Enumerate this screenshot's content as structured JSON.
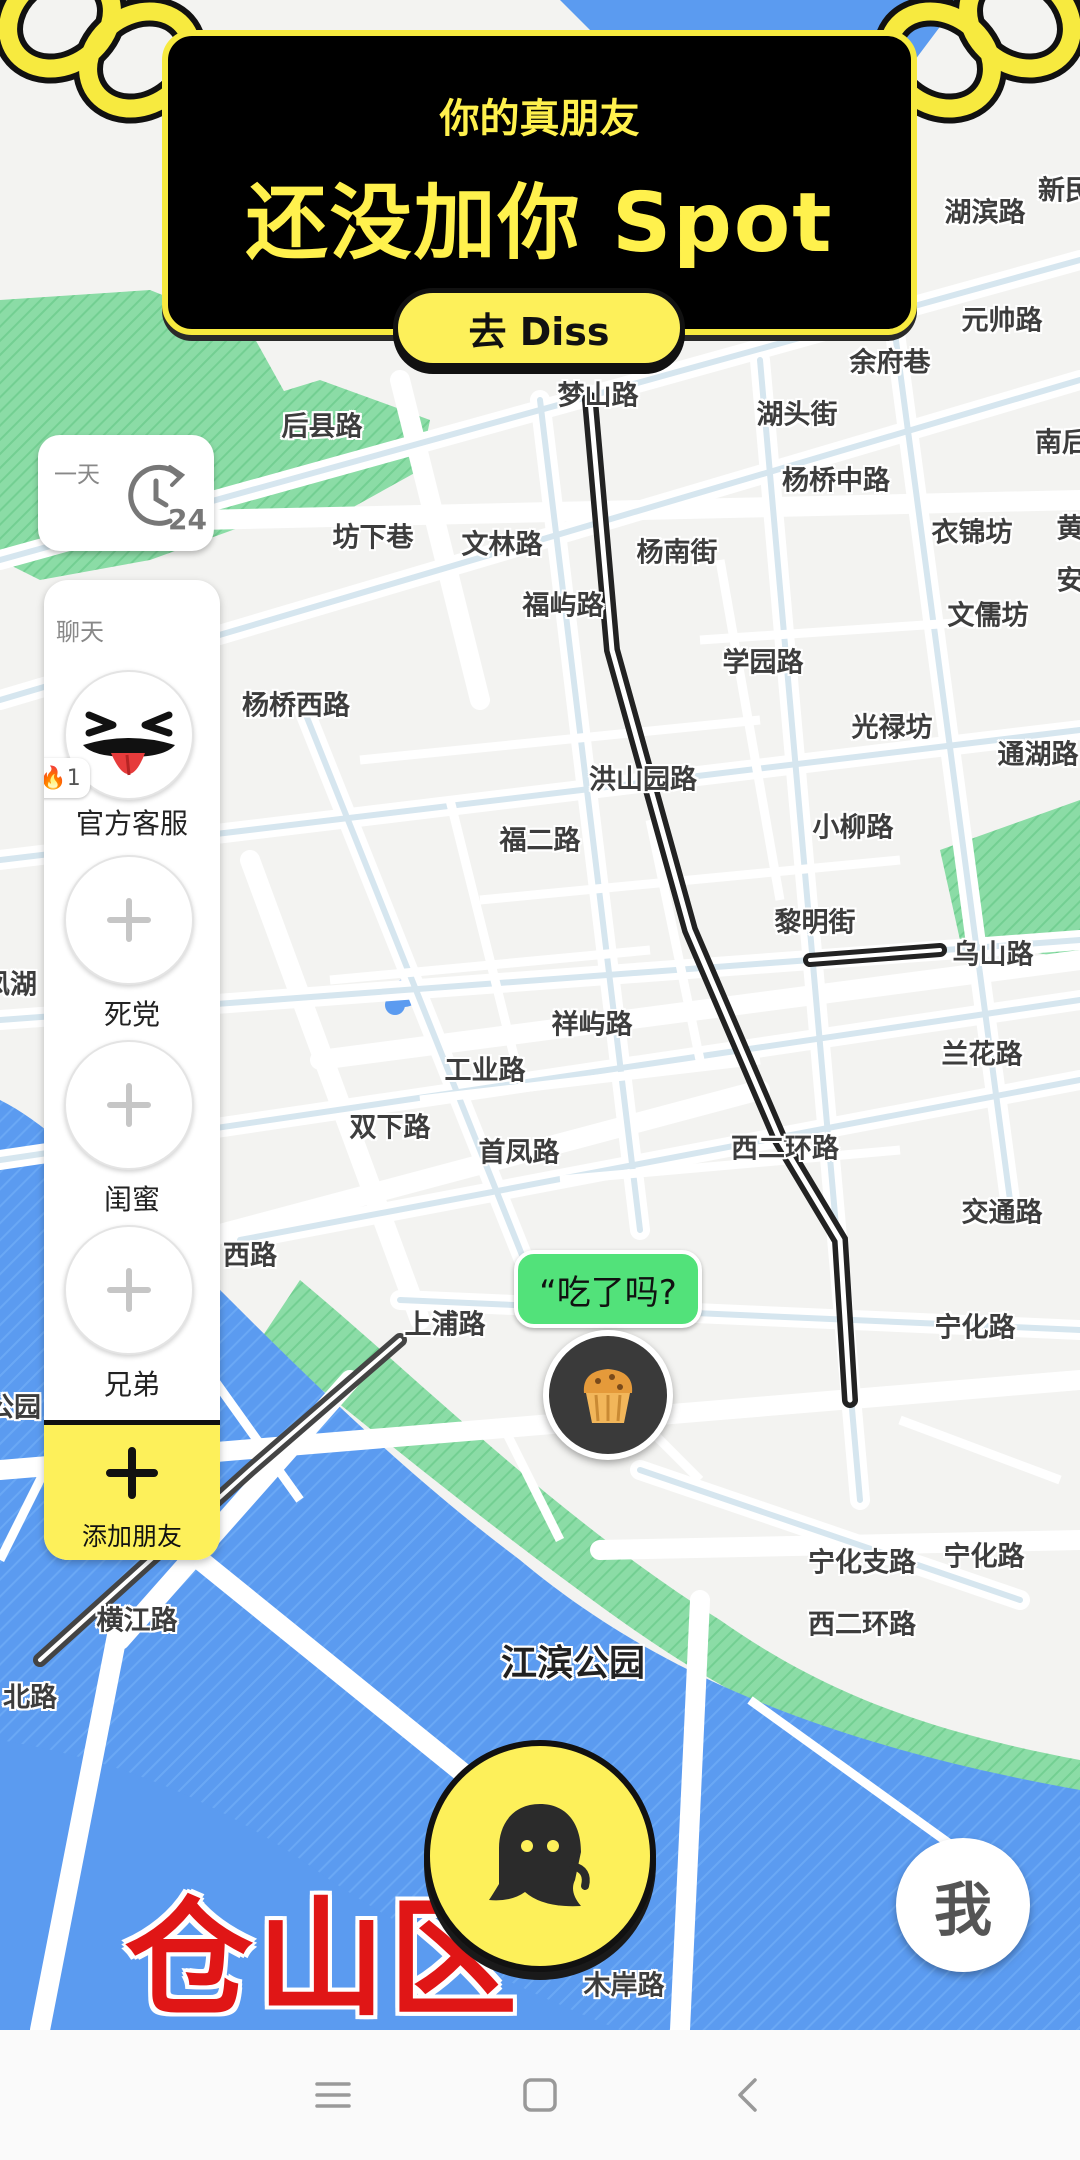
{
  "banner": {
    "subtitle": "你的真朋友",
    "title": "还没加你 Spot",
    "action_label": "去 Diss"
  },
  "time_filter": {
    "label": "一天",
    "icon": "clock-24-icon"
  },
  "friends_panel": {
    "label": "聊天",
    "items": [
      {
        "name": "官方客服",
        "badge_count": "1",
        "type": "avatar"
      },
      {
        "name": "死党",
        "type": "add-slot"
      },
      {
        "name": "闺蜜",
        "type": "add-slot"
      },
      {
        "name": "兄弟",
        "type": "add-slot"
      }
    ],
    "add_label": "添加朋友"
  },
  "user_marker": {
    "status_text": "“吃了吗?",
    "avatar_icon": "muffin-icon"
  },
  "map": {
    "district": "仓山区",
    "park": "江滨公园",
    "streets": [
      "湖滨路",
      "新民",
      "元帅路",
      "余府巷",
      "梦山路",
      "湖头街",
      "南后",
      "后县路",
      "杨桥中路",
      "坊下巷",
      "文林路",
      "杨南街",
      "衣锦坊",
      "黄",
      "安",
      "福屿路",
      "文儒坊",
      "学园路",
      "杨桥西路",
      "光禄坊",
      "通湖路",
      "洪山园路",
      "福二路",
      "小柳路",
      "黎明街",
      "乌山路",
      "祥屿路",
      "兰花路",
      "工业路",
      "双下路",
      "首凤路",
      "西二环路",
      "交通路",
      "西路",
      "上浦路",
      "宁化路",
      "宁化支路",
      "宁化路",
      "西二环路",
      "横江路",
      "北路",
      "木岸路",
      "凤湖",
      "公园"
    ]
  },
  "controls": {
    "ghost_icon": "ghost-icon",
    "me_label": "我"
  },
  "navbar": {
    "icons": [
      "menu-icon",
      "home-square-icon",
      "back-icon"
    ]
  },
  "colors": {
    "accent_yellow": "#fdf05a",
    "banner_bg": "#000000",
    "bubble_green": "#52e27a",
    "district_red": "#e01616",
    "water": "#5b9bf0",
    "park": "#7fd79c"
  }
}
